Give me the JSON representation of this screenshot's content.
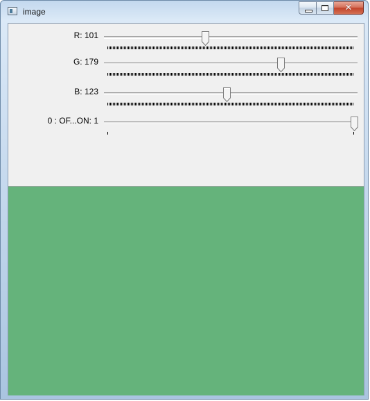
{
  "window": {
    "title": "image",
    "icon": "window-app-icon",
    "controls": {
      "minimize": "minimize-icon",
      "maximize": "maximize-icon",
      "close": "close-icon",
      "close_glyph": "✕"
    }
  },
  "trackbars": [
    {
      "label": "R: 101",
      "value": 101,
      "max": 255
    },
    {
      "label": "G: 179",
      "value": 179,
      "max": 255
    },
    {
      "label": "B: 123",
      "value": 123,
      "max": 255
    },
    {
      "label": "0 : OF...ON: 1",
      "value": 1,
      "max": 1
    }
  ],
  "canvas": {
    "color": "#65b37b"
  }
}
